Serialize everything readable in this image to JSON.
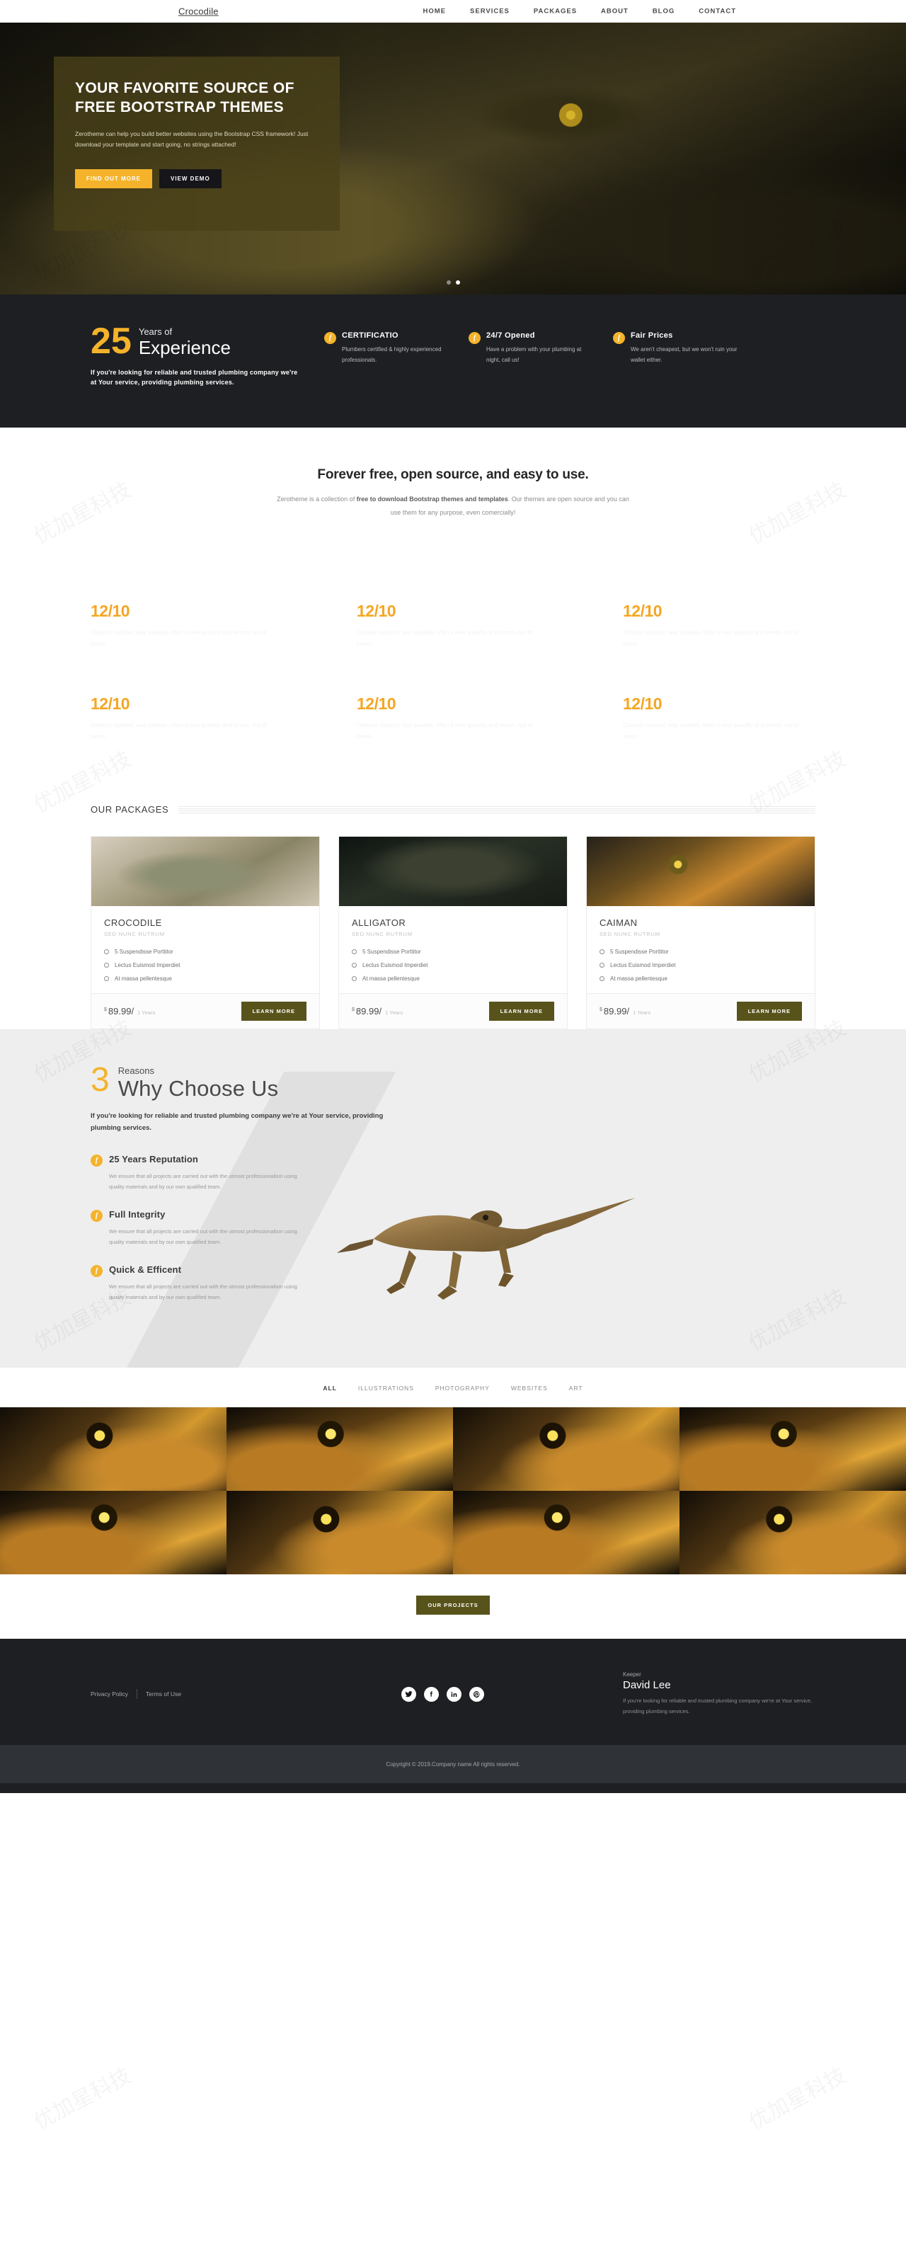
{
  "nav": {
    "brand": "Crocodile",
    "links": [
      {
        "label": "HOME",
        "active": true
      },
      {
        "label": "SERVICES",
        "active": false
      },
      {
        "label": "PACKAGES",
        "active": false
      },
      {
        "label": "ABOUT",
        "active": false
      },
      {
        "label": "BLOG",
        "active": false
      },
      {
        "label": "CONTACT",
        "active": false
      }
    ]
  },
  "hero": {
    "title": "YOUR FAVORITE SOURCE OF FREE BOOTSTRAP THEMES",
    "paragraph": "Zerotheme can help you build better websites using the Bootstrap CSS framework! Just download your template and start going, no strings attached!",
    "primary_btn": "FIND OUT MORE",
    "secondary_btn": "VIEW DEMO",
    "slide_count": 2,
    "active_slide": 2
  },
  "experience": {
    "number": "25",
    "years_of": "Years of",
    "word": "Experience",
    "description": "If you're looking for reliable and trusted plumbing company we're at Your service, providing plumbing services.",
    "features": [
      {
        "icon": "facebook-circle-icon",
        "title": "CERTIFICATIO",
        "text": "Plumbers certified & highly experienced professionals."
      },
      {
        "icon": "facebook-circle-icon",
        "title": "24/7 Opened",
        "text": "Have a problem with your plumbing at night, call us!"
      },
      {
        "icon": "facebook-circle-icon",
        "title": "Fair Prices",
        "text": "We aren't cheapest, but we won't ruin your wallet either."
      }
    ]
  },
  "free_section": {
    "heading": "Forever free, open source, and easy to use.",
    "text_before": "Zerotheme is a collection of ",
    "text_bold": "free to download Bootstrap themes and templates",
    "text_after": ". Our themes are open source and you can use them for any purpose, even comercially!"
  },
  "stats_grid": [
    {
      "number": "12/10",
      "text": "Outdoor, outdoor, wax sandals, often a new quantity and lemon, out of lorem."
    },
    {
      "number": "12/10",
      "text": "Outdoor, outdoor, wax sandals, often a new quantity and lemon, out of lorem."
    },
    {
      "number": "12/10",
      "text": "Outdoor, outdoor, wax sandals, often a new quantity and lemon, out of lorem."
    },
    {
      "number": "12/10",
      "text": "Outdoor, outdoor, wax sandals, often a new quantity and lemon, out of lorem."
    },
    {
      "number": "12/10",
      "text": "Outdoor, outdoor, wax sandals, often a new quantity and lemon, out of lorem."
    },
    {
      "number": "12/10",
      "text": "Outdoor, outdoor, wax sandals, often a new quantity and lemon, out of lorem."
    }
  ],
  "packages": {
    "heading": "OUR PACKAGES",
    "cards": [
      {
        "title": "CROCODILE",
        "subtitle": "SED NUNC RUTRUM",
        "features": [
          "5 Suspendisse Porttitor",
          "Lectus Euismod Imperdiet",
          "At massa pellentesque"
        ],
        "currency": "$",
        "amount": "89.99/",
        "period": "1 Years",
        "button": "LEARN MORE",
        "image_alt": "crocodile-photo"
      },
      {
        "title": "ALLIGATOR",
        "subtitle": "SED NUNC RUTRUM",
        "features": [
          "5 Suspendisse Porttitor",
          "Lectus Euismod Imperdiet",
          "At massa pellentesque"
        ],
        "currency": "$",
        "amount": "89.99/",
        "period": "1 Years",
        "button": "LEARN MORE",
        "image_alt": "alligator-photo"
      },
      {
        "title": "CAIMAN",
        "subtitle": "SED NUNC RUTRUM",
        "features": [
          "5 Suspendisse Porttitor",
          "Lectus Euismod Imperdiet",
          "At massa pellentesque"
        ],
        "currency": "$",
        "amount": "89.99/",
        "period": "1 Years",
        "button": "LEARN MORE",
        "image_alt": "caiman-photo"
      }
    ]
  },
  "why": {
    "count": "3",
    "reasons_label": "Reasons",
    "heading": "Why Choose Us",
    "subheading": "If you're looking for reliable and trusted plumbing company we're at Your service, providing plumbing services.",
    "items": [
      {
        "icon": "facebook-circle-icon",
        "title": "25 Years Reputation",
        "text": "We ensure that all projects are carried out with the utmost professionalism using quality materials and by our own qualified team."
      },
      {
        "icon": "facebook-circle-icon",
        "title": "Full Integrity",
        "text": "We ensure that all projects are carried out with the utmost professionalism using quality materials and by our own qualified team."
      },
      {
        "icon": "facebook-circle-icon",
        "title": "Quick & Efficent",
        "text": "We ensure that all projects are carried out with the utmost professionalism using quality materials and by our own qualified team."
      }
    ]
  },
  "portfolio": {
    "filters": [
      {
        "label": "ALL",
        "active": true
      },
      {
        "label": "ILLUSTRATIONS",
        "active": false
      },
      {
        "label": "PHOTOGRAPHY",
        "active": false
      },
      {
        "label": "WEBSITES",
        "active": false
      },
      {
        "label": "ART",
        "active": false
      }
    ],
    "tiles": 8,
    "button": "OUR PROJECTS"
  },
  "footer": {
    "privacy": "Privacy Policy",
    "terms": "Terms of Use",
    "social": [
      "twitter-icon",
      "facebook-icon",
      "linkedin-icon",
      "pinterest-icon"
    ],
    "person": {
      "role": "Keeper",
      "name": "David Lee",
      "bio": "If you're looking for reliable and trusted plumbing company we're at Your service, providing plumbing services."
    },
    "copyright": "Copyright © 2019.Company name All rights reserved."
  },
  "colors": {
    "amber": "#f5b32b",
    "olive": "#58531a",
    "dark": "#1d1f22",
    "light_gray": "#eeeeee"
  }
}
